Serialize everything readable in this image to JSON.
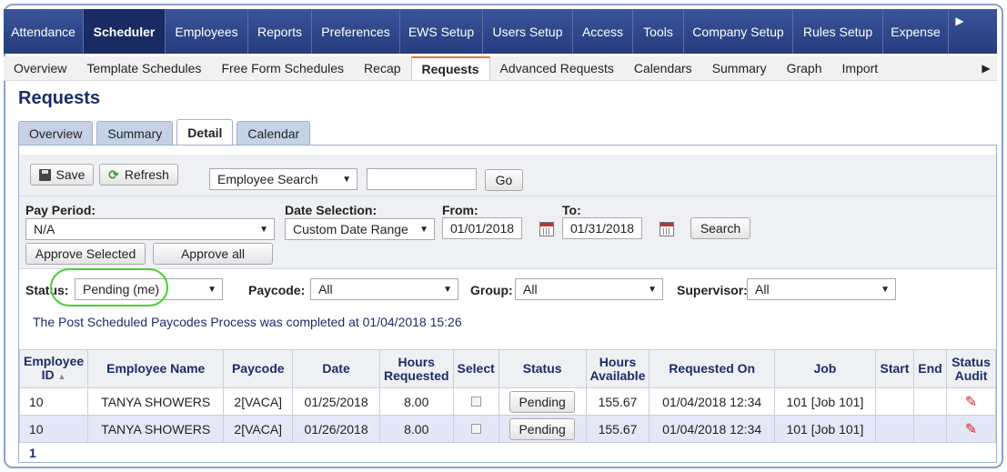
{
  "topnav": {
    "items": [
      "Attendance",
      "Scheduler",
      "Employees",
      "Reports",
      "Preferences",
      "EWS Setup",
      "Users Setup",
      "Access",
      "Tools",
      "Company Setup",
      "Rules Setup",
      "Expense"
    ],
    "active": "Scheduler",
    "more_icon": "triangle-right"
  },
  "subnav": {
    "items": [
      "Overview",
      "Template Schedules",
      "Free Form Schedules",
      "Recap",
      "Requests",
      "Advanced Requests",
      "Calendars",
      "Summary",
      "Graph",
      "Import"
    ],
    "active": "Requests",
    "more_icon": "triangle-right"
  },
  "page_title": "Requests",
  "tabs": {
    "items": [
      "Overview",
      "Summary",
      "Detail",
      "Calendar"
    ],
    "active": "Detail"
  },
  "toolbar": {
    "save_label": "Save",
    "refresh_label": "Refresh",
    "search_type": "Employee Search",
    "search_value": "",
    "go_label": "Go"
  },
  "filters": {
    "pay_period_label": "Pay Period:",
    "pay_period_value": "N/A",
    "date_selection_label": "Date Selection:",
    "date_selection_value": "Custom Date Range",
    "from_label": "From:",
    "from_value": "01/01/2018",
    "to_label": "To:",
    "to_value": "01/31/2018",
    "search_label": "Search",
    "approve_selected_label": "Approve Selected",
    "approve_all_label": "Approve all",
    "status_label": "Status:",
    "status_value": "Pending (me)",
    "paycode_label": "Paycode:",
    "paycode_value": "All",
    "group_label": "Group:",
    "group_value": "All",
    "supervisor_label": "Supervisor:",
    "supervisor_value": "All"
  },
  "message": "The Post Scheduled Paycodes Process was completed at 01/04/2018 15:26",
  "table": {
    "headers": [
      "Employee ID",
      "Employee Name",
      "Paycode",
      "Date",
      "Hours Requested",
      "Select",
      "Status",
      "Hours Available",
      "Requested On",
      "Job",
      "Start",
      "End",
      "Status Audit"
    ],
    "rows": [
      {
        "id": "10",
        "name": "TANYA SHOWERS",
        "paycode": "2[VACA]",
        "date": "01/25/2018",
        "hours": "8.00",
        "status": "Pending",
        "available": "155.67",
        "requested_on": "01/04/2018 12:34",
        "job": "101 [Job 101]",
        "start": "",
        "end": ""
      },
      {
        "id": "10",
        "name": "TANYA SHOWERS",
        "paycode": "2[VACA]",
        "date": "01/26/2018",
        "hours": "8.00",
        "status": "Pending",
        "available": "155.67",
        "requested_on": "01/04/2018 12:34",
        "job": "101 [Job 101]",
        "start": "",
        "end": ""
      }
    ]
  },
  "pager": "1",
  "colors": {
    "nav_bg": "#263d7d",
    "title": "#1b2d66",
    "highlight": "#46d12e",
    "accent": "#e87722"
  }
}
